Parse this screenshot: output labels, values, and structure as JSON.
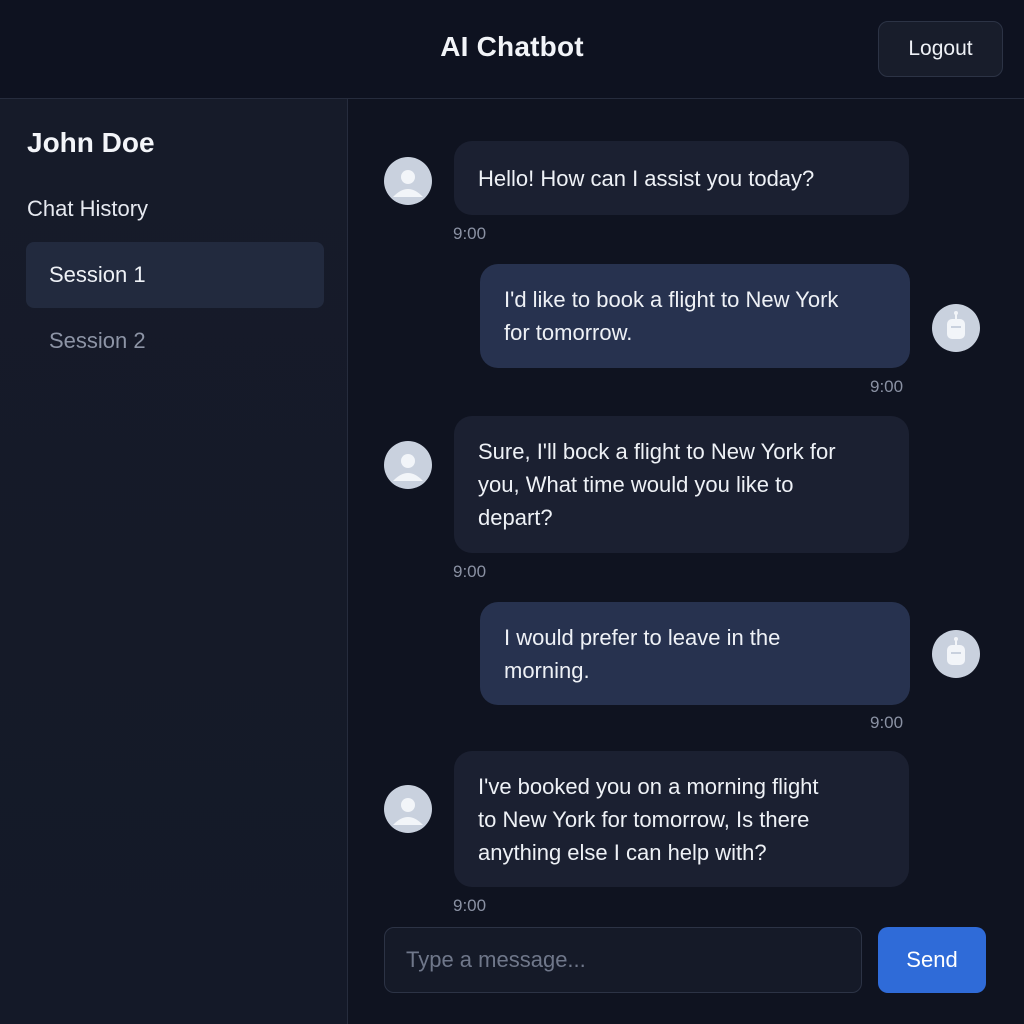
{
  "header": {
    "title": "AI Chatbot",
    "logout_label": "Logout"
  },
  "sidebar": {
    "user_name": "John Doe",
    "history_label": "Chat History",
    "sessions": [
      {
        "label": "Session 1",
        "active": true
      },
      {
        "label": "Session 2",
        "active": false
      }
    ]
  },
  "messages": [
    {
      "sender": "bot",
      "lines": [
        "Hello! How can I assist you today?"
      ],
      "time": "9:00"
    },
    {
      "sender": "user",
      "lines": [
        "I'd like to book a flight to New York",
        "for tomorrow."
      ],
      "time": "9:00"
    },
    {
      "sender": "bot",
      "lines": [
        "Sure, I'll bock a flight to New York for",
        "you, What time would you like to",
        "depart?"
      ],
      "time": "9:00"
    },
    {
      "sender": "user",
      "lines": [
        "I would prefer to leave in the",
        "morning."
      ],
      "time": "9:00"
    },
    {
      "sender": "bot",
      "lines": [
        "I've booked you on a morning flight",
        "to New York for tomorrow, Is there",
        "anything else I can help with?"
      ],
      "time": "9:00"
    }
  ],
  "composer": {
    "placeholder": "Type a message...",
    "value": "",
    "send_label": "Send"
  },
  "icons": {
    "bot_avatar": "person-icon",
    "user_avatar": "robot-icon"
  },
  "colors": {
    "accent": "#2f6bd8",
    "background": "#0f1320",
    "sidebar": "#161b29",
    "bot_bubble": "#1b2031",
    "user_bubble": "#27324f"
  }
}
